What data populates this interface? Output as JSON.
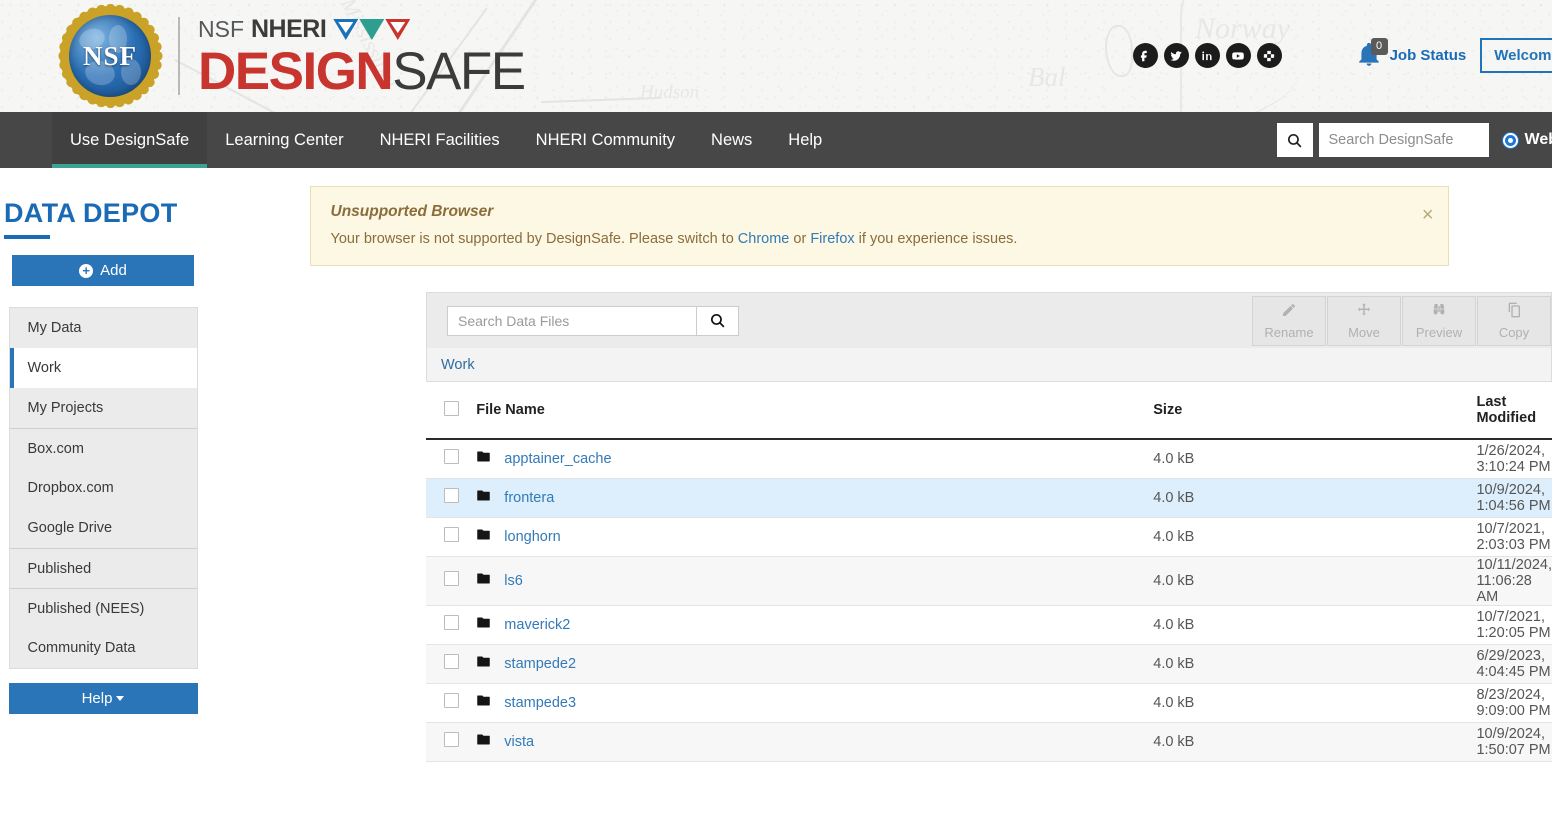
{
  "header": {
    "logo": {
      "seal_text": "NSF",
      "nsf_small": "NSF",
      "nheri_word": "NHERI",
      "design": "DESIGN",
      "safe": "SAFE"
    },
    "social": [
      {
        "name": "facebook-icon",
        "label": "f"
      },
      {
        "name": "twitter-icon",
        "label": "t"
      },
      {
        "name": "linkedin-icon",
        "label": "in"
      },
      {
        "name": "youtube-icon",
        "label": "yt"
      },
      {
        "name": "slack-icon",
        "label": "sl"
      }
    ],
    "job_status": {
      "badge": "0",
      "label": "Job Status"
    },
    "welcome_button": "Welcome,",
    "map_words": {
      "w1": "Norway",
      "w2": "Bal",
      "w3": "Mississippi",
      "w4": "Hudson"
    }
  },
  "nav": {
    "items": [
      {
        "label": "Use DesignSafe",
        "active": true
      },
      {
        "label": "Learning Center",
        "active": false
      },
      {
        "label": "NHERI Facilities",
        "active": false
      },
      {
        "label": "NHERI Community",
        "active": false
      },
      {
        "label": "News",
        "active": false
      },
      {
        "label": "Help",
        "active": false
      }
    ],
    "search_placeholder": "Search DesignSafe",
    "scope_label": "Web"
  },
  "alert": {
    "title": "Unsupported Browser",
    "text_before": "Your browser is not supported by DesignSafe. Please switch to ",
    "link_chrome": "Chrome",
    "text_middle": " or ",
    "link_firefox": "Firefox",
    "text_after": " if you experience issues.",
    "close": "×"
  },
  "sidebar": {
    "title": "DATA DEPOT",
    "add_label": "Add",
    "items": [
      {
        "label": "My Data",
        "active": false,
        "group_top": false
      },
      {
        "label": "Work",
        "active": true,
        "group_top": false
      },
      {
        "label": "My Projects",
        "active": false,
        "group_top": false
      },
      {
        "label": "Box.com",
        "active": false,
        "group_top": true
      },
      {
        "label": "Dropbox.com",
        "active": false,
        "group_top": false
      },
      {
        "label": "Google Drive",
        "active": false,
        "group_top": false
      },
      {
        "label": "Published",
        "active": false,
        "group_top": true
      },
      {
        "label": "Published (NEES)",
        "active": false,
        "group_top": true
      },
      {
        "label": "Community Data",
        "active": false,
        "group_top": false
      }
    ],
    "help_label": "Help"
  },
  "datadepot": {
    "search_placeholder": "Search Data Files",
    "breadcrumb": "Work",
    "toolbar": [
      {
        "label": "Rename",
        "icon": "pencil-icon",
        "disabled": true
      },
      {
        "label": "Move",
        "icon": "move-arrows-icon",
        "disabled": true
      },
      {
        "label": "Preview",
        "icon": "binoculars-icon",
        "disabled": true
      },
      {
        "label": "Copy",
        "icon": "copy-icon",
        "disabled": true
      }
    ],
    "columns": [
      "File Name",
      "Size",
      "Last Modified"
    ],
    "rows": [
      {
        "name": "apptainer_cache",
        "size": "4.0 kB",
        "modified": "1/26/2024, 3:10:24 PM",
        "hovered": false
      },
      {
        "name": "frontera",
        "size": "4.0 kB",
        "modified": "10/9/2024, 1:04:56 PM",
        "hovered": true
      },
      {
        "name": "longhorn",
        "size": "4.0 kB",
        "modified": "10/7/2021, 2:03:03 PM",
        "hovered": false
      },
      {
        "name": "ls6",
        "size": "4.0 kB",
        "modified": "10/11/2024, 11:06:28 AM",
        "hovered": false
      },
      {
        "name": "maverick2",
        "size": "4.0 kB",
        "modified": "10/7/2021, 1:20:05 PM",
        "hovered": false
      },
      {
        "name": "stampede2",
        "size": "4.0 kB",
        "modified": "6/29/2023, 4:04:45 PM",
        "hovered": false
      },
      {
        "name": "stampede3",
        "size": "4.0 kB",
        "modified": "8/23/2024, 9:09:00 PM",
        "hovered": false
      },
      {
        "name": "vista",
        "size": "4.0 kB",
        "modified": "10/9/2024, 1:50:07 PM",
        "hovered": false
      }
    ]
  },
  "colors": {
    "brand_blue": "#2a74b8",
    "brand_red": "#c8352f",
    "nav_bg": "#474747",
    "accent_teal": "#3aa396",
    "link_blue": "#337ab7",
    "row_hover": "#ddeffc",
    "alert_bg": "#fcf8e3",
    "alert_text": "#8a6d3b"
  }
}
